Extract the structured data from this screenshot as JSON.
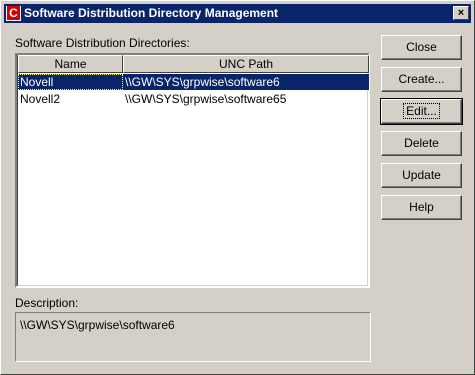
{
  "window": {
    "title": "Software Distribution Directory Management",
    "close_glyph": "×",
    "icon": "app-icon"
  },
  "list": {
    "label": "Software Distribution Directories:",
    "columns": [
      "Name",
      "UNC Path"
    ],
    "rows": [
      {
        "name": "Novell",
        "path": "\\\\GW\\SYS\\grpwise\\software6",
        "selected": true
      },
      {
        "name": "Novell2",
        "path": "\\\\GW\\SYS\\grpwise\\software65",
        "selected": false
      }
    ]
  },
  "description": {
    "label": "Description:",
    "value": "\\\\GW\\SYS\\grpwise\\software6"
  },
  "buttons": {
    "close": "Close",
    "create": "Create...",
    "edit": "Edit...",
    "delete": "Delete",
    "update": "Update",
    "help": "Help"
  },
  "colors": {
    "selection": "#0a246a",
    "face": "#d4d0c8"
  }
}
